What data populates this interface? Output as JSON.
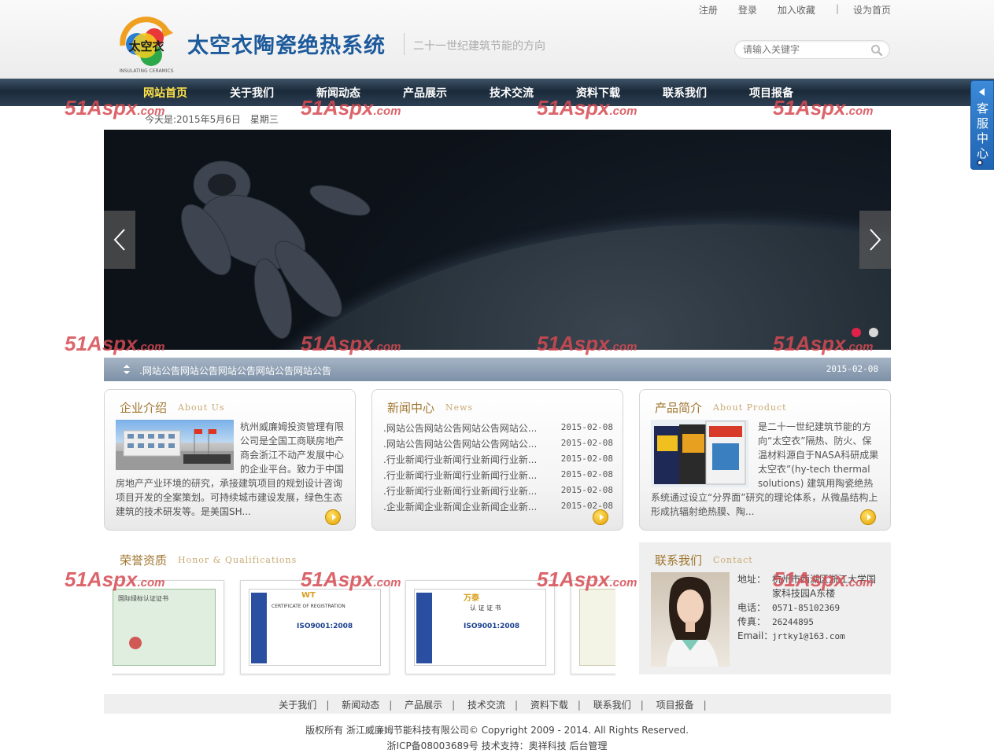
{
  "colors": {
    "nav_bg": "#1a2a3a",
    "nav_active": "#ffe34a",
    "accent_gold": "#a0762f",
    "title_blue": "#1c5a9c",
    "service_blue": "#2f78c6",
    "dot_active": "#e0224a"
  },
  "header": {
    "top_links": [
      "注册",
      "登录",
      "加入收藏",
      "设为首页"
    ],
    "logo_text": "太空衣",
    "logo_ring_text": "INSULATING CERAMICS",
    "site_title": "太空衣陶瓷绝热系统",
    "slogan": "二十一世纪建筑节能的方向",
    "search_placeholder": "请输入关键字",
    "search_icon": "search-icon"
  },
  "nav": {
    "items": [
      "网站首页",
      "关于我们",
      "新闻动态",
      "产品展示",
      "技术交流",
      "资料下载",
      "联系我们",
      "项目报备"
    ],
    "active_index": 0
  },
  "service_tab": {
    "label": "客服中心"
  },
  "date_line": "今天是:2015年5月6日　星期三",
  "banner": {
    "slide_count": 2,
    "active_slide": 1
  },
  "notice": {
    "text": ".网站公告网站公告网站公告网站公告网站公告",
    "date": "2015-02-08"
  },
  "about": {
    "title": "企业介绍",
    "title_en": "About Us",
    "text": "杭州威廉姆投资管理有限公司是全国工商联房地产商会浙江不动产发展中心的企业平台。致力于中国房地产产业环境的研究，承接建筑项目的规划设计咨询项目开发的全案策划。可持续城市建设发展，绿色生态建筑的技术研发等。是美国SH..."
  },
  "news": {
    "title": "新闻中心",
    "title_en": "News",
    "items": [
      {
        "title": ".网站公告网站公告网站公告网站公...",
        "date": "2015-02-08"
      },
      {
        "title": ".网站公告网站公告网站公告网站公...",
        "date": "2015-02-08"
      },
      {
        "title": ".行业新闻行业新闻行业新闻行业新...",
        "date": "2015-02-08"
      },
      {
        "title": ".行业新闻行业新闻行业新闻行业新...",
        "date": "2015-02-08"
      },
      {
        "title": ".行业新闻行业新闻行业新闻行业新...",
        "date": "2015-02-08"
      },
      {
        "title": ".企业新闻企业新闻企业新闻企业新...",
        "date": "2015-02-08"
      }
    ]
  },
  "product": {
    "title": "产品简介",
    "title_en": "About Product",
    "text": "是二十一世纪建筑节能的方向“太空衣”隔热、防火、保温材料源自于NASA科研成果 太空衣”(hy-tech thermal solutions) 建筑用陶瓷绝热系统通过设立“分界面”研究的理论体系，从微晶结构上形成抗辐射绝热膜、陶..."
  },
  "honor": {
    "title": "荣誉资质",
    "title_en": "Honor & Qualifications",
    "certificates": [
      {
        "heading": "国际绿标认证证书"
      },
      {
        "heading": "CERTIFICATE OF REGISTRATION",
        "standard": "ISO9001:2008",
        "brand": "WT"
      },
      {
        "heading": "认 证 证 书",
        "standard": "ISO9001:2008",
        "brand": "万泰"
      },
      {
        "heading": ""
      }
    ]
  },
  "contact": {
    "title": "联系我们",
    "title_en": "Contact",
    "address_label": "地址：",
    "address": "杭州市西湖区浙江大学国家科技园A东楼",
    "phone_label": "电话：",
    "phone": "0571-85102369",
    "fax_label": "传真：",
    "fax": "26244895",
    "email_label": "Email：",
    "email": "jrtky1@163.com"
  },
  "footer": {
    "links": [
      "关于我们",
      "新闻动态",
      "产品展示",
      "技术交流",
      "资料下载",
      "联系我们",
      "项目报备"
    ],
    "copyright": "版权所有 浙江威廉姆节能科技有限公司© Copyright 2009 - 2014. All Rights Reserved.",
    "icp_prefix": "浙ICP备08003689号 技术支持：",
    "tech_support": "奥祥科技",
    "admin_link": "后台管理"
  },
  "watermark": {
    "big": "51Aspx",
    "small": ".com"
  }
}
